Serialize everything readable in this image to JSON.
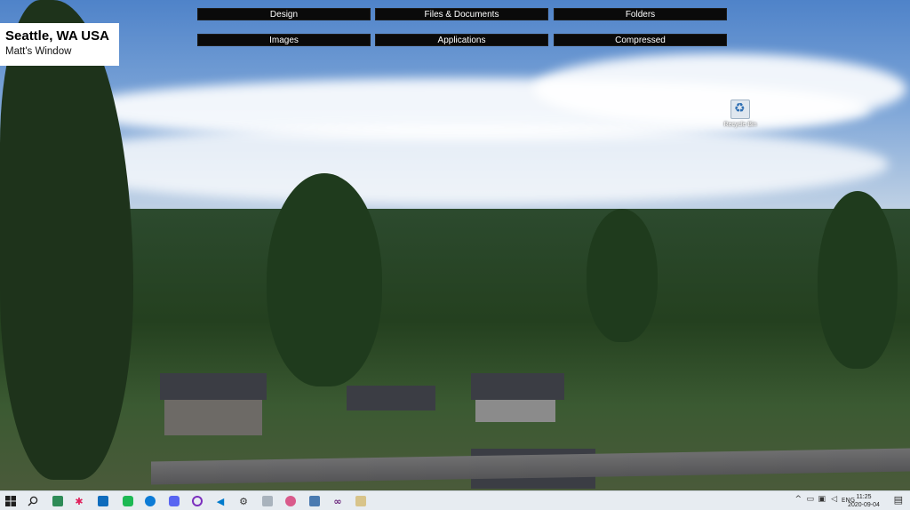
{
  "location": {
    "title": "Seattle, WA USA",
    "subtitle": "Matt's Window"
  },
  "toolbar": {
    "buttons": [
      {
        "label": "Design"
      },
      {
        "label": "Files & Documents"
      },
      {
        "label": "Folders"
      },
      {
        "label": "Images"
      },
      {
        "label": "Applications"
      },
      {
        "label": "Compressed"
      }
    ]
  },
  "desktop": {
    "icons": [
      {
        "label": "Recycle Bin",
        "icon": "recycle-bin-icon"
      }
    ]
  },
  "taskbar": {
    "apps": [
      {
        "name": "start",
        "icon": "windows-logo-icon"
      },
      {
        "name": "search",
        "icon": "search-icon"
      },
      {
        "name": "task-view",
        "icon": "task-view-icon"
      },
      {
        "name": "app-1",
        "icon": "green-app-icon",
        "color": "#2e8b57"
      },
      {
        "name": "app-2",
        "icon": "slack-icon",
        "color": "#e01e5a"
      },
      {
        "name": "app-3",
        "icon": "outlook-icon",
        "color": "#0f6cbd"
      },
      {
        "name": "app-4",
        "icon": "spotify-icon",
        "color": "#1db954"
      },
      {
        "name": "app-5",
        "icon": "edge-icon",
        "color": "#0c7bd6"
      },
      {
        "name": "app-6",
        "icon": "discord-icon",
        "color": "#5865f2"
      },
      {
        "name": "app-7",
        "icon": "circle-app-icon",
        "color": "#7b2fbe"
      },
      {
        "name": "app-8",
        "icon": "vscode-icon",
        "color": "#007acc"
      },
      {
        "name": "app-9",
        "icon": "settings-icon",
        "color": "#333333"
      },
      {
        "name": "app-10",
        "icon": "photos-icon",
        "color": "#7a7a7a"
      },
      {
        "name": "app-11",
        "icon": "paint-icon",
        "color": "#d95a8b"
      },
      {
        "name": "app-12",
        "icon": "tool-icon",
        "color": "#4a7ab0"
      },
      {
        "name": "app-13",
        "icon": "visual-studio-icon",
        "color": "#68217a"
      },
      {
        "name": "app-14",
        "icon": "notes-icon",
        "color": "#b38b2a"
      }
    ],
    "tray": {
      "language": "ENG",
      "time": "11:25",
      "date": "2020-09-04"
    }
  }
}
